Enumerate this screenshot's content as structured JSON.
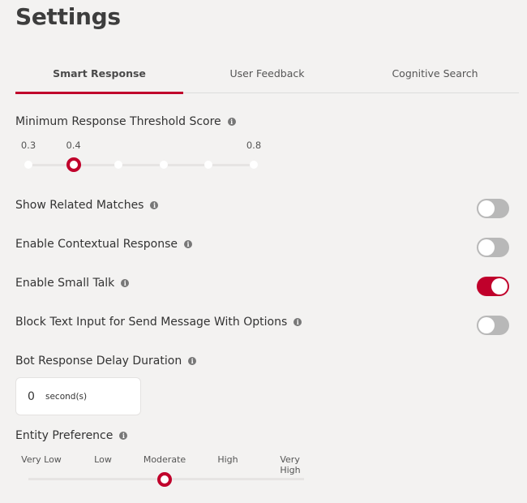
{
  "page": {
    "title": "Settings"
  },
  "tabs": [
    {
      "label": "Smart Response",
      "active": true
    },
    {
      "label": "User Feedback",
      "active": false
    },
    {
      "label": "Cognitive Search",
      "active": false
    }
  ],
  "threshold": {
    "label": "Minimum Response Threshold Score",
    "ticks": [
      "0.3",
      "0.4",
      "",
      "",
      "",
      "0.8"
    ],
    "labeled_ticks": {
      "min": "0.3",
      "selected": "0.4",
      "max": "0.8"
    },
    "value": 0.4,
    "min": 0.3,
    "max": 0.8,
    "step_count": 6
  },
  "toggles": [
    {
      "label": "Show Related Matches",
      "on": false
    },
    {
      "label": "Enable Contextual Response",
      "on": false
    },
    {
      "label": "Enable Small Talk",
      "on": true
    },
    {
      "label": "Block Text Input for Send Message With Options",
      "on": false
    }
  ],
  "delay": {
    "label": "Bot Response Delay Duration",
    "value": "0",
    "unit": "second(s)"
  },
  "entity": {
    "label": "Entity Preference",
    "options": [
      "Very Low",
      "Low",
      "Moderate",
      "High",
      "Very High"
    ],
    "selected": "Moderate",
    "selected_index": 2
  },
  "colors": {
    "accent": "#c0002b",
    "toggle_off": "#b8b8b8",
    "background": "#f3f2f1"
  }
}
